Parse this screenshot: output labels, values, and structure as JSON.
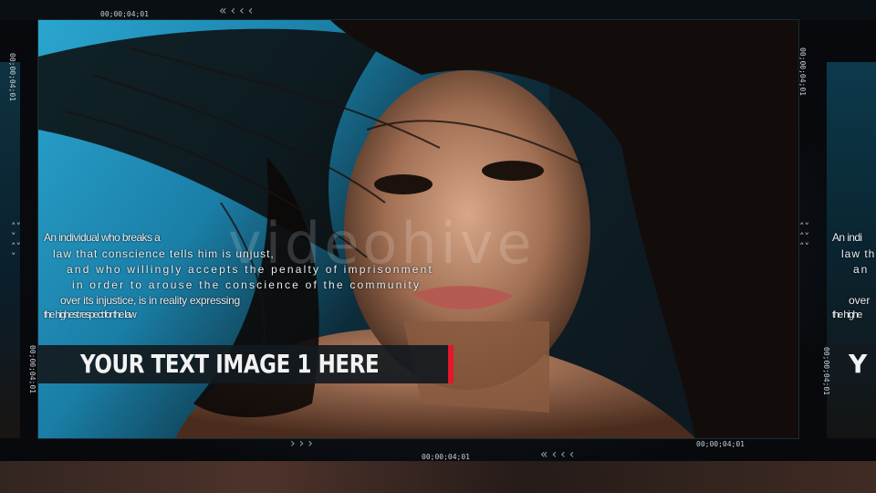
{
  "caption": {
    "main": "YOUR TEXT IMAGE 1 HERE",
    "right_partial": "Y"
  },
  "quote": {
    "lines": [
      "An individual who breaks a",
      "law that conscience tells him is unjust,",
      "and who willingly accepts the penalty of imprisonment",
      "in order to arouse the conscience of the community",
      "over its injustice, is in reality expressing",
      "the highest respect for the law"
    ],
    "right_fragments": [
      "An indi",
      "law th",
      "an",
      "over",
      "the highe"
    ]
  },
  "watermark": "videohive",
  "timecodes": {
    "top": "00;00;04;01",
    "bottom": "00;00;04;01",
    "right": "00;00;04;01",
    "left_vertical_top": "00;00;04;01",
    "left_vertical_bottom": "00;00;04;01",
    "right_vertical_top": "00;00;04;01",
    "right_vertical_bottom": "00;00;04;01"
  },
  "chevrons": {
    "top": "«‹‹‹",
    "bottom_right": "›››",
    "bottom_left": "«‹‹‹",
    "side_left": "˄˅\n˅\n˄˅\n˅",
    "side_right": "˄˅\n˄˅\n˄˅"
  },
  "colors": {
    "accent": "#e3182b",
    "caption_bg": "#141a20",
    "sky": "#1a8fb8"
  },
  "icons": {
    "photo": "portrait-photo",
    "watermark_logo": "videohive-logo"
  }
}
